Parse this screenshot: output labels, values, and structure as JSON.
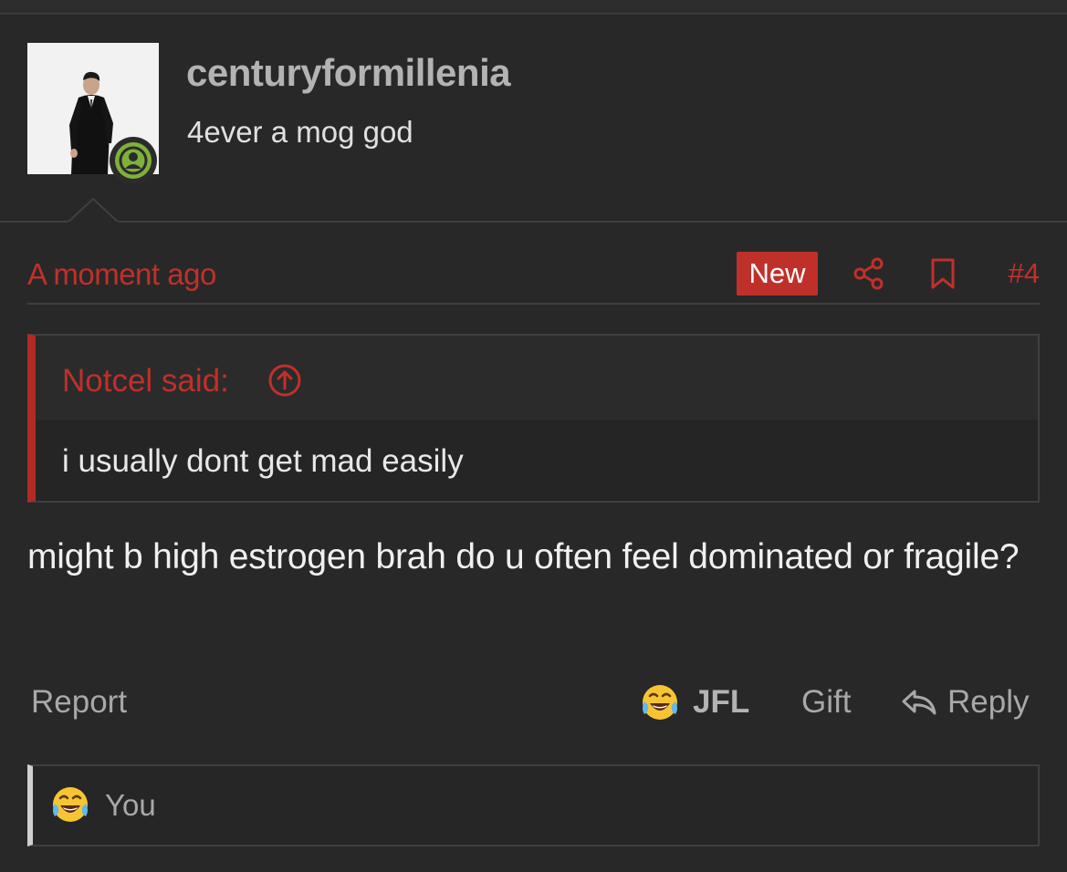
{
  "user": {
    "username": "centuryformillenia",
    "title": "4ever a mog god"
  },
  "post": {
    "timestamp": "A moment ago",
    "new_badge": "New",
    "number": "#4",
    "quote": {
      "author_label": "Notcel said:",
      "text": "i usually dont get mad easily"
    },
    "message": "might b high estrogen brah do u often feel dominated or fragile?"
  },
  "actions": {
    "report": "Report",
    "reaction": "JFL",
    "gift": "Gift",
    "reply": "Reply"
  },
  "reactions_bar": {
    "names": "You"
  },
  "icons": {
    "online": "user-online-icon",
    "share": "share-icon",
    "bookmark": "bookmark-icon",
    "quote_up": "arrow-up-circle-icon",
    "laugh": "tears-of-joy-emoji-icon",
    "reply": "reply-arrow-icon"
  },
  "colors": {
    "accent": "#c0302a",
    "online": "#7fb13a",
    "background": "#282828"
  }
}
